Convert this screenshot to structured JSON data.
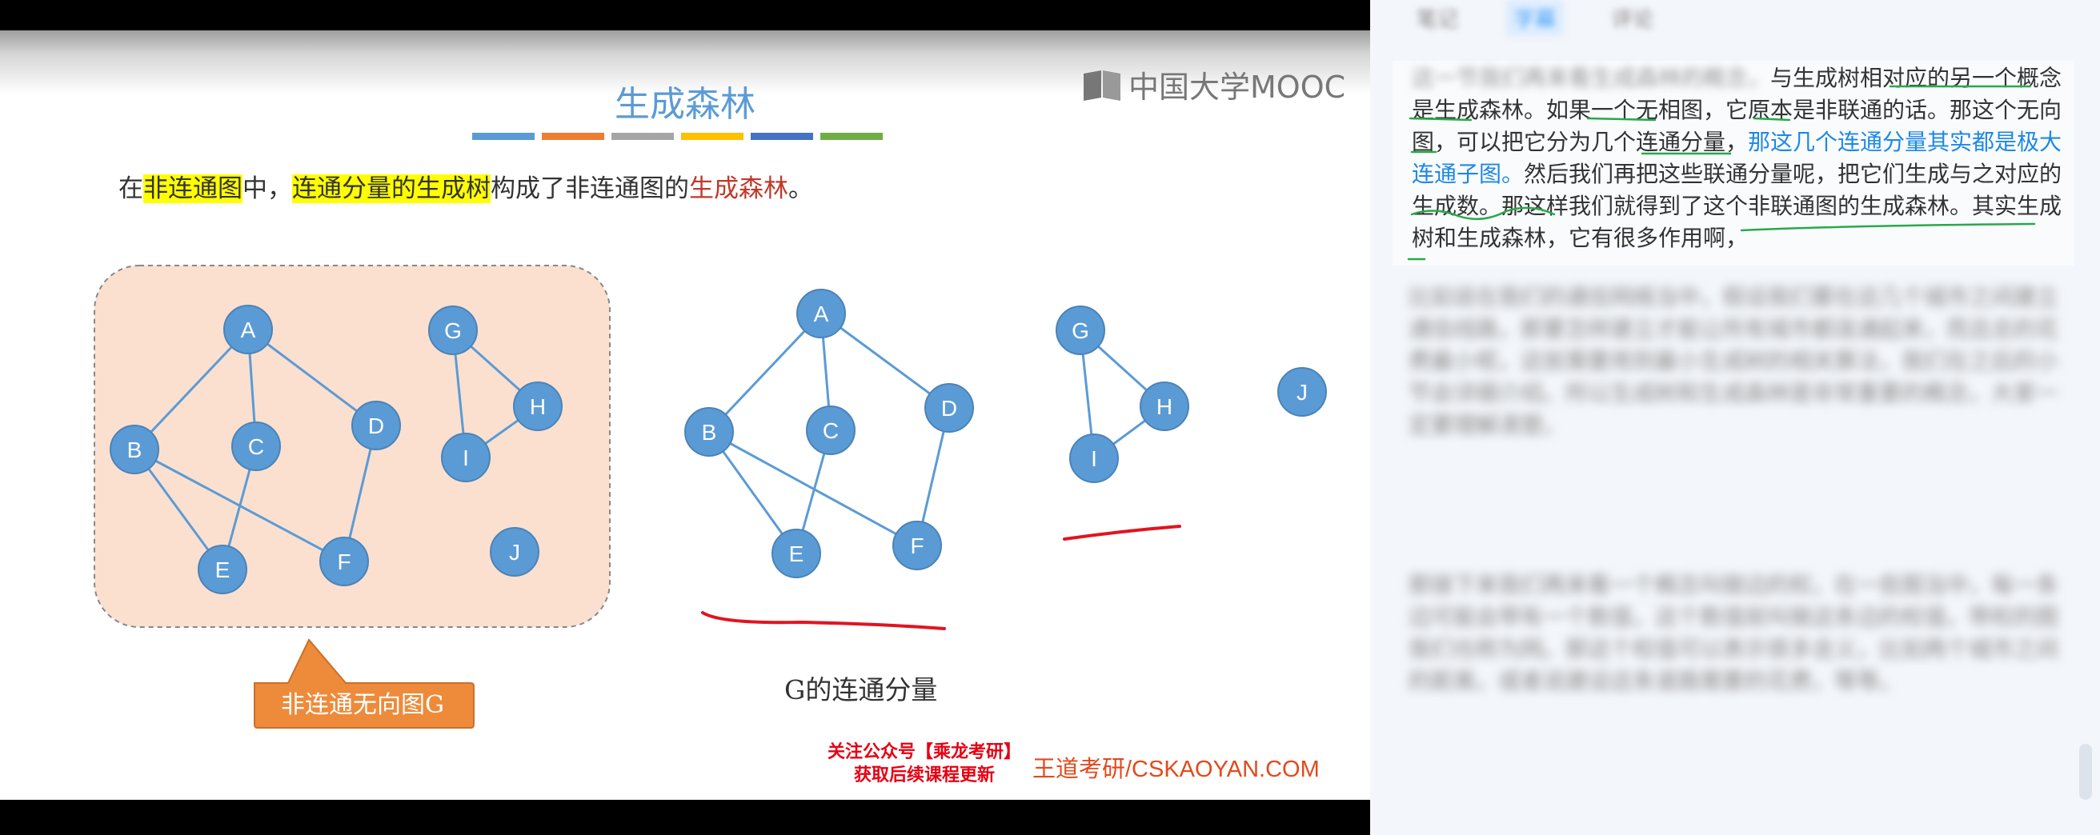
{
  "slide": {
    "title": "生成森林",
    "logo_text": "中国大学MOOC",
    "stripe_colors": [
      "#5b9bd5",
      "#ed7d31",
      "#a5a5a5",
      "#ffc000",
      "#4472c4",
      "#70ad47"
    ],
    "def_parts": [
      "在",
      "非连通图",
      "中，",
      "连通分量的生成树",
      "构成了非连通图的",
      "生成森林",
      "。"
    ],
    "callout": "非连通无向图G",
    "caption": "G的连通分量",
    "wechat_line1": "关注公众号【乘龙考研】",
    "wechat_line2": "获取后续课程更新",
    "site": "王道考研/CSKAOYAN.COM",
    "nodes_left": [
      "A",
      "B",
      "C",
      "D",
      "E",
      "F",
      "G",
      "H",
      "I",
      "J"
    ],
    "nodes_comp1": [
      "A",
      "B",
      "C",
      "D",
      "E",
      "F"
    ],
    "nodes_comp2": [
      "G",
      "H",
      "I"
    ],
    "nodes_comp3": [
      "J"
    ],
    "colors": {
      "node": "#5b9bd5",
      "edge": "#5b9bd5",
      "region": "#fbe0cf",
      "callout": "#ed8b3b",
      "underline": "#e0151f"
    }
  },
  "panel": {
    "tabs": [
      "笔记",
      "字幕",
      "评论"
    ],
    "note_prefix": "这一节我们再来看生成森林的概念，",
    "note_parts": [
      "与生成树相对应的另一个概念是生成森林。如果一个无相图，它原本是非联通的话。那这个无向图，可以把它分为几个连通分量，",
      "那这几个连通分量其实都是极大连通子图。",
      "然后我们再把这些联通分量呢，把它们生成与之对应的生成数。那这样我们就得到了这个非联通图的生成森林。其实生成树和生成森林，它有很多作用啊，"
    ],
    "blurred_1": "比如说在我们的通信网络当中，假设我们要在这几个城市之间建立通信线路，那要怎样建立才能让所有城市都连通起来，而且总的花费最小呢，这就需要用到最小生成树的相关算法，我们在之后的小节会详细介绍。所以生成树和生成森林是非常重要的概念，大家一定要理解清楚。",
    "blurred_2": "那接下来我们再来看一个概念叫做边的权，在一些图当中，每一条边可能会带有一个数值，这个数值就叫做这条边的权值，带权的图我们也称为网。那这个权值可以表示很多含义，比如两个城市之间的距离，或者说建设这条道路需要的花费，等等。"
  }
}
